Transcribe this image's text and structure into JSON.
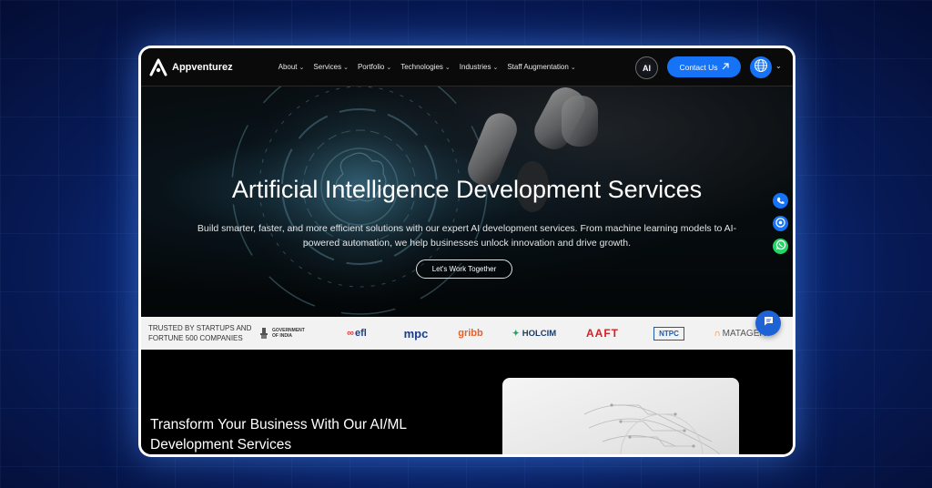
{
  "nav": {
    "brand": "Appventurez",
    "items": [
      {
        "label": "About"
      },
      {
        "label": "Services"
      },
      {
        "label": "Portfolio"
      },
      {
        "label": "Technologies"
      },
      {
        "label": "Industries"
      },
      {
        "label": "Staff Augmentation"
      }
    ],
    "ai_label": "AI",
    "contact_label": "Contact Us"
  },
  "hero": {
    "title": "Artificial Intelligence Development Services",
    "subtitle": "Build smarter, faster, and more efficient solutions with our expert AI development services. From machine learning models to AI-powered automation, we help businesses unlock innovation and drive growth.",
    "cta": "Let's Work Together"
  },
  "trust": {
    "line1": "TRUSTED BY STARTUPS AND",
    "line2": "FORTUNE 500 COMPANIES",
    "brands": [
      {
        "name": "GOVERNMENT OF INDIA",
        "color": "#333333"
      },
      {
        "name": "efl",
        "color": "#1a3f8f"
      },
      {
        "name": "mpc",
        "color": "#1c3d8c"
      },
      {
        "name": "gribb",
        "color": "#e2622f"
      },
      {
        "name": "HOLCIM",
        "color": "#1b3c6b"
      },
      {
        "name": "AAFT",
        "color": "#d62027"
      },
      {
        "name": "NTPC",
        "color": "#1f5aa6"
      },
      {
        "name": "MATAGER",
        "color": "#555555"
      }
    ]
  },
  "lower": {
    "title": "Transform Your Business With Our AI/ML Development Services"
  },
  "colors": {
    "accent": "#1673f5",
    "whatsapp": "#25d366"
  }
}
